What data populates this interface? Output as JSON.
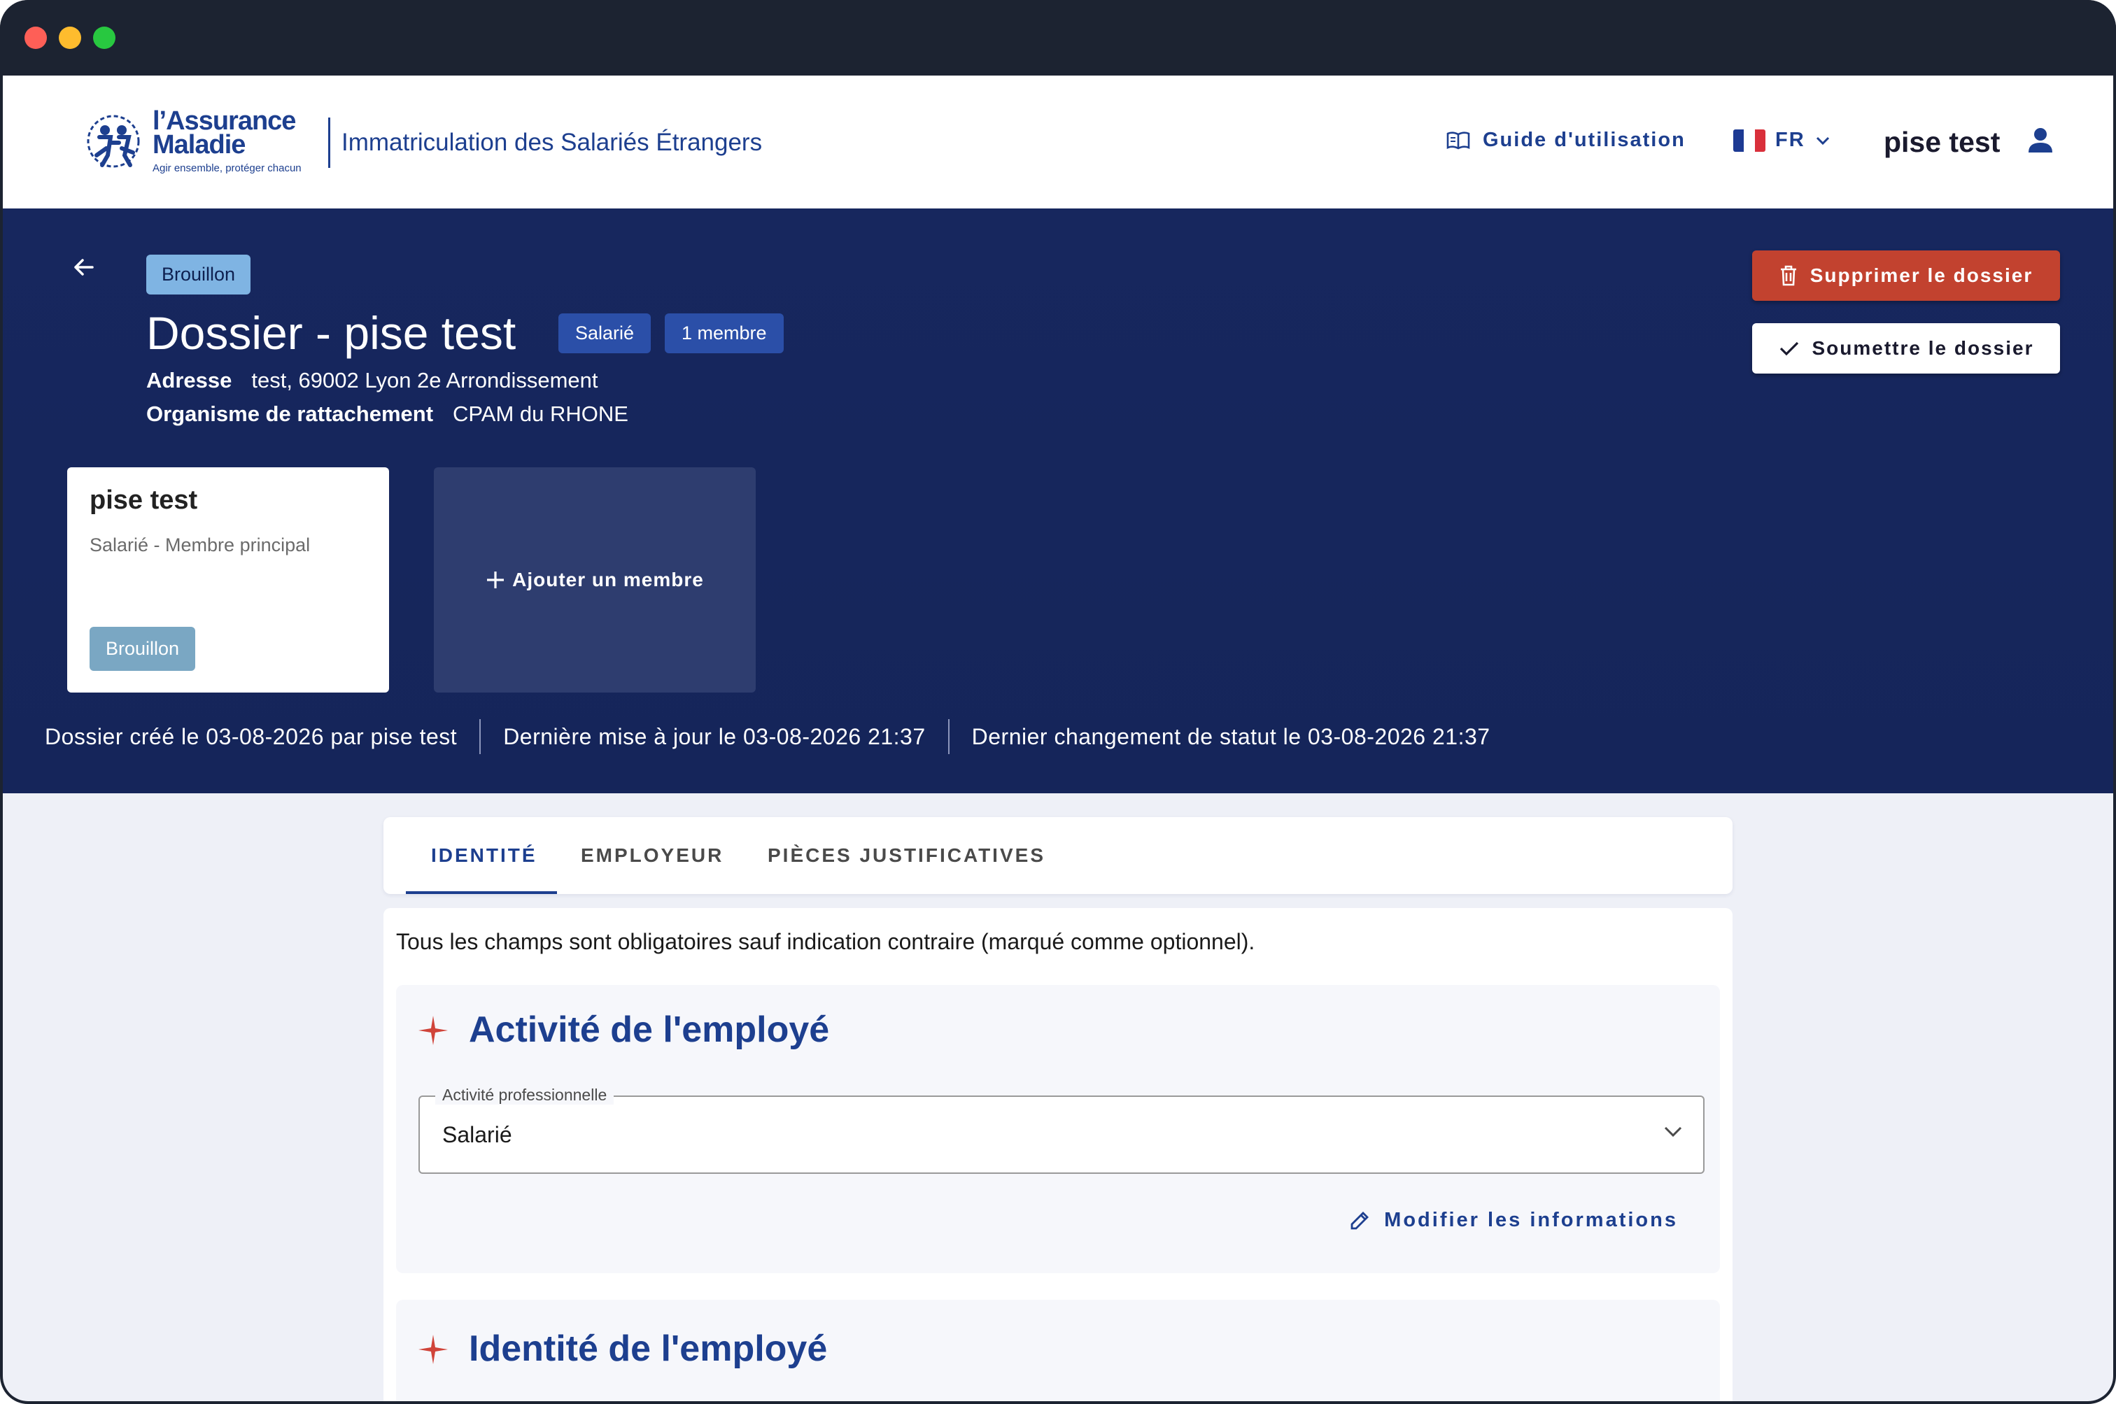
{
  "header": {
    "logo_line1": "l’Assurance",
    "logo_line2": "Maladie",
    "logo_tagline": "Agir ensemble, protéger chacun",
    "app_title": "Immatriculation des Salariés Étrangers",
    "guide_label": "Guide d'utilisation",
    "language": "FR",
    "user_name": "pise test"
  },
  "dossier": {
    "status_badge": "Brouillon",
    "title": "Dossier - pise test",
    "type_badge": "Salarié",
    "members_badge": "1 membre",
    "address_label": "Adresse",
    "address_value": "test, 69002 Lyon 2e Arrondissement",
    "organism_label": "Organisme de rattachement",
    "organism_value": "CPAM du RHONE",
    "delete_label": "Supprimer le dossier",
    "submit_label": "Soumettre le dossier"
  },
  "members": [
    {
      "name": "pise test",
      "role": "Salarié - Membre principal",
      "status": "Brouillon"
    }
  ],
  "add_member_label": "Ajouter un membre",
  "meta": {
    "created": "Dossier créé le 03-08-2026 par pise test",
    "updated": "Dernière mise à jour le 03-08-2026 21:37",
    "status_changed": "Dernier changement de statut le 03-08-2026 21:37"
  },
  "tabs": [
    {
      "label": "IDENTITÉ",
      "active": true
    },
    {
      "label": "EMPLOYEUR",
      "active": false
    },
    {
      "label": "PIÈCES JUSTIFICATIVES",
      "active": false
    }
  ],
  "form": {
    "note": "Tous les champs sont obligatoires sauf indication contraire (marqué comme optionnel).",
    "section1_title": "Activité de l'employé",
    "activity_label": "Activité professionnelle",
    "activity_value": "Salarié",
    "modify_label": "Modifier les informations",
    "section2_title": "Identité de l'employé"
  },
  "colors": {
    "primary": "#1d3f8f",
    "hero_bg": "#17275e",
    "danger": "#c2422f",
    "draft_badge": "#7fb4e3",
    "accent_star": "#d0443a"
  },
  "icons": {
    "back": "arrow-left-icon",
    "guide": "book-icon",
    "lang_flag": "france-flag-icon",
    "user": "person-icon",
    "delete": "trash-icon",
    "submit": "check-icon",
    "add": "plus-icon",
    "select": "chevron-down-icon",
    "modify": "pencil-icon",
    "section": "sparkle-icon"
  }
}
